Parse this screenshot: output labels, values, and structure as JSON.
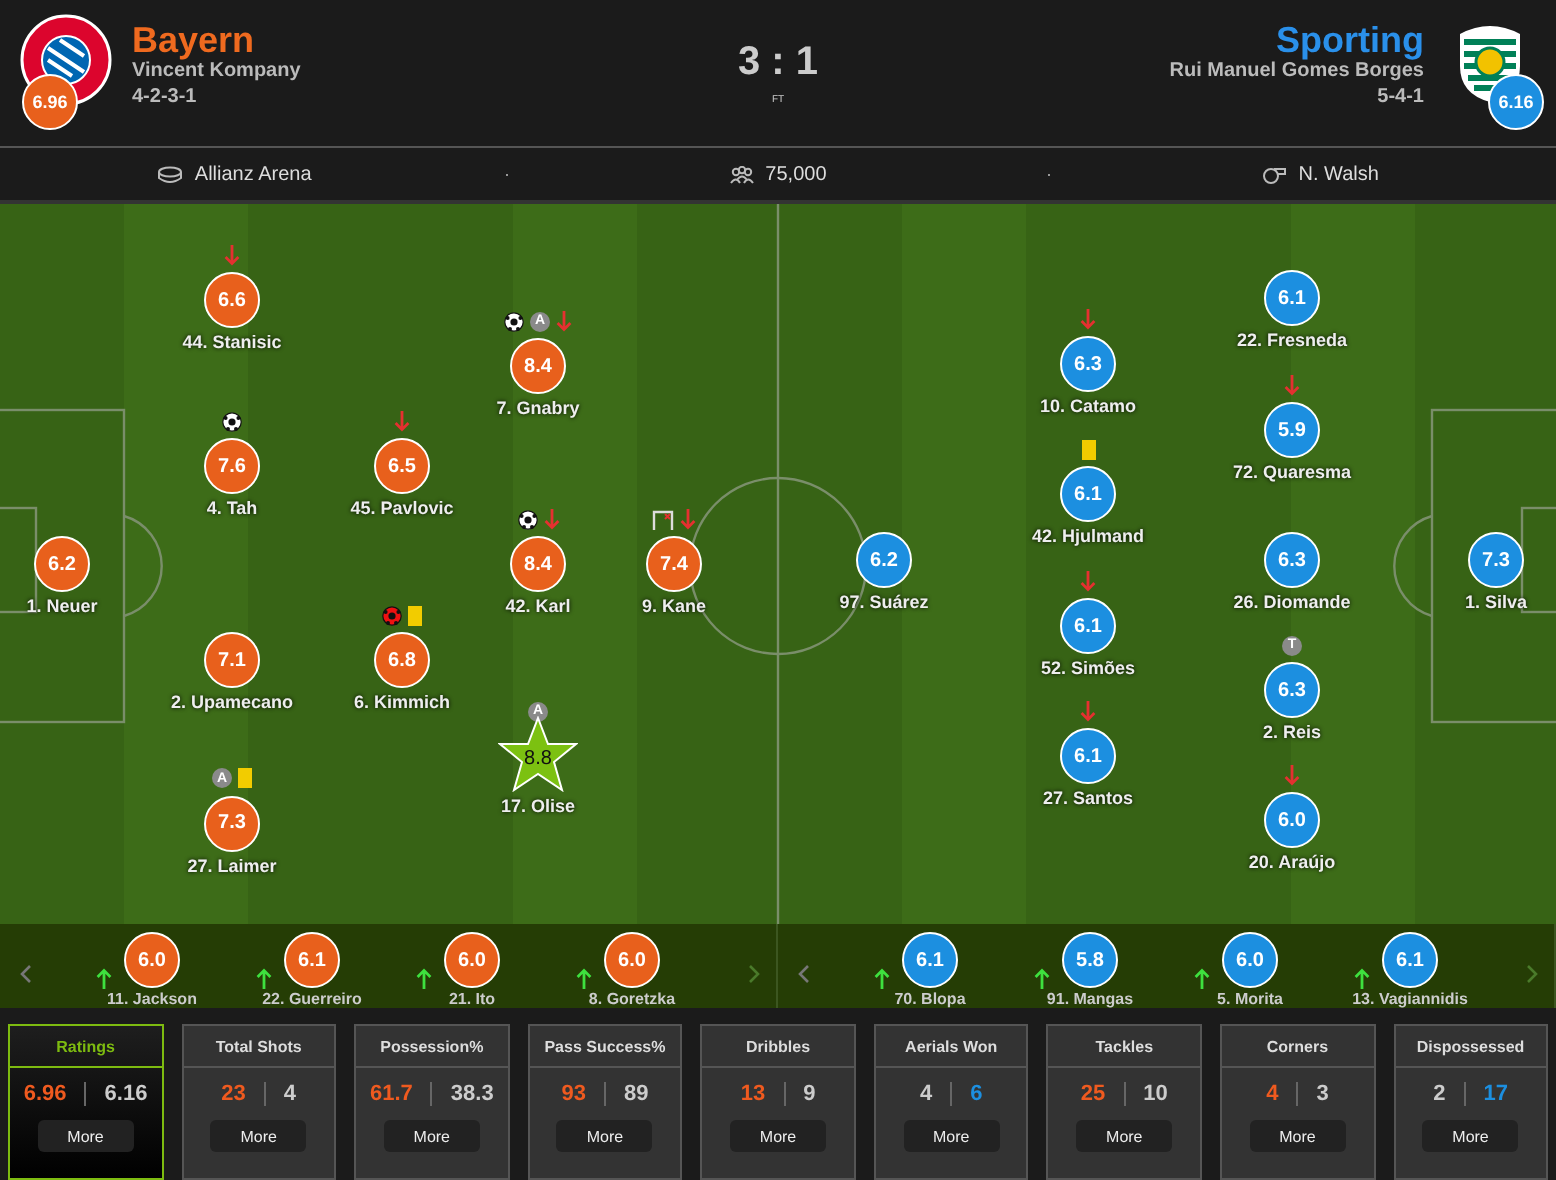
{
  "score": "3 : 1",
  "status": "FT",
  "home": {
    "name": "Bayern",
    "manager": "Vincent Kompany",
    "formation": "4-2-3-1",
    "rating": "6.96",
    "players": [
      {
        "label": "1. Neuer",
        "rating": "6.2",
        "motm": false
      },
      {
        "label": "44. Stanisic",
        "rating": "6.6",
        "motm": false,
        "events": [
          {
            "kind": "sub_off"
          }
        ]
      },
      {
        "label": "4. Tah",
        "rating": "7.6",
        "motm": false,
        "events": [
          {
            "kind": "goal"
          }
        ]
      },
      {
        "label": "2. Upamecano",
        "rating": "7.1",
        "motm": false
      },
      {
        "label": "27. Laimer",
        "rating": "7.3",
        "motm": false,
        "events": [
          {
            "kind": "badge",
            "text": "A"
          },
          {
            "kind": "yellow"
          }
        ]
      },
      {
        "label": "45. Pavlovic",
        "rating": "6.5",
        "motm": false,
        "events": [
          {
            "kind": "sub_off"
          }
        ]
      },
      {
        "label": "6. Kimmich",
        "rating": "6.8",
        "motm": false,
        "events": [
          {
            "kind": "own_goal"
          },
          {
            "kind": "yellow"
          }
        ]
      },
      {
        "label": "7. Gnabry",
        "rating": "8.4",
        "motm": false,
        "events": [
          {
            "kind": "goal"
          },
          {
            "kind": "badge",
            "text": "A"
          },
          {
            "kind": "sub_off"
          }
        ]
      },
      {
        "label": "42. Karl",
        "rating": "8.4",
        "motm": false,
        "events": [
          {
            "kind": "goal"
          },
          {
            "kind": "sub_off"
          }
        ]
      },
      {
        "label": "17. Olise",
        "rating": "8.8",
        "motm": true,
        "events": [
          {
            "kind": "badge",
            "text": "A"
          }
        ]
      },
      {
        "label": "9. Kane",
        "rating": "7.4",
        "motm": false,
        "events": [
          {
            "kind": "woodwork"
          },
          {
            "kind": "sub_off"
          }
        ]
      }
    ],
    "subs": [
      {
        "label": "11. Jackson",
        "rating": "6.0"
      },
      {
        "label": "22. Guerreiro",
        "rating": "6.1"
      },
      {
        "label": "21. Ito",
        "rating": "6.0"
      },
      {
        "label": "8. Goretzka",
        "rating": "6.0"
      }
    ]
  },
  "away": {
    "name": "Sporting",
    "manager": "Rui Manuel Gomes Borges",
    "formation": "5-4-1",
    "rating": "6.16",
    "players": [
      {
        "label": "97. Suárez",
        "rating": "6.2",
        "motm": false
      },
      {
        "label": "10. Catamo",
        "rating": "6.3",
        "motm": false,
        "events": [
          {
            "kind": "sub_off"
          }
        ]
      },
      {
        "label": "42. Hjulmand",
        "rating": "6.1",
        "motm": false,
        "events": [
          {
            "kind": "yellow"
          }
        ]
      },
      {
        "label": "52. Simões",
        "rating": "6.1",
        "motm": false,
        "events": [
          {
            "kind": "sub_off"
          }
        ]
      },
      {
        "label": "27. Santos",
        "rating": "6.1",
        "motm": false,
        "events": [
          {
            "kind": "sub_off"
          }
        ]
      },
      {
        "label": "22. Fresneda",
        "rating": "6.1",
        "motm": false
      },
      {
        "label": "72. Quaresma",
        "rating": "5.9",
        "motm": false,
        "events": [
          {
            "kind": "sub_off"
          }
        ]
      },
      {
        "label": "26. Diomande",
        "rating": "6.3",
        "motm": false
      },
      {
        "label": "2. Reis",
        "rating": "6.3",
        "motm": false,
        "events": [
          {
            "kind": "badge",
            "text": "T"
          }
        ]
      },
      {
        "label": "20. Araújo",
        "rating": "6.0",
        "motm": false,
        "events": [
          {
            "kind": "sub_off"
          }
        ]
      },
      {
        "label": "1. Silva",
        "rating": "7.3",
        "motm": false
      }
    ],
    "subs": [
      {
        "label": "70. Blopa",
        "rating": "6.1"
      },
      {
        "label": "91. Mangas",
        "rating": "5.8"
      },
      {
        "label": "5. Morita",
        "rating": "6.0"
      },
      {
        "label": "13. Vagiannidis",
        "rating": "6.1"
      }
    ]
  },
  "info": {
    "venue": "Allianz Arena",
    "attendance": "75,000",
    "referee": "N. Walsh"
  },
  "stats": [
    {
      "title": "Ratings",
      "home": "6.96",
      "away": "6.16",
      "selected": true,
      "button": "More"
    },
    {
      "title": "Total Shots",
      "home": "23",
      "away": "4",
      "selected": false,
      "button": "More"
    },
    {
      "title": "Possession%",
      "home": "61.7",
      "away": "38.3",
      "selected": false,
      "button": "More"
    },
    {
      "title": "Pass Success%",
      "home": "93",
      "away": "89",
      "selected": false,
      "button": "More"
    },
    {
      "title": "Dribbles",
      "home": "13",
      "away": "9",
      "selected": false,
      "button": "More"
    },
    {
      "title": "Aerials Won",
      "home": "4",
      "away": "6",
      "selected": false,
      "button": "More"
    },
    {
      "title": "Tackles",
      "home": "25",
      "away": "10",
      "selected": false,
      "button": "More"
    },
    {
      "title": "Corners",
      "home": "4",
      "away": "3",
      "selected": false,
      "button": "More"
    },
    {
      "title": "Dispossessed",
      "home": "2",
      "away": "17",
      "selected": false,
      "button": "More"
    }
  ]
}
